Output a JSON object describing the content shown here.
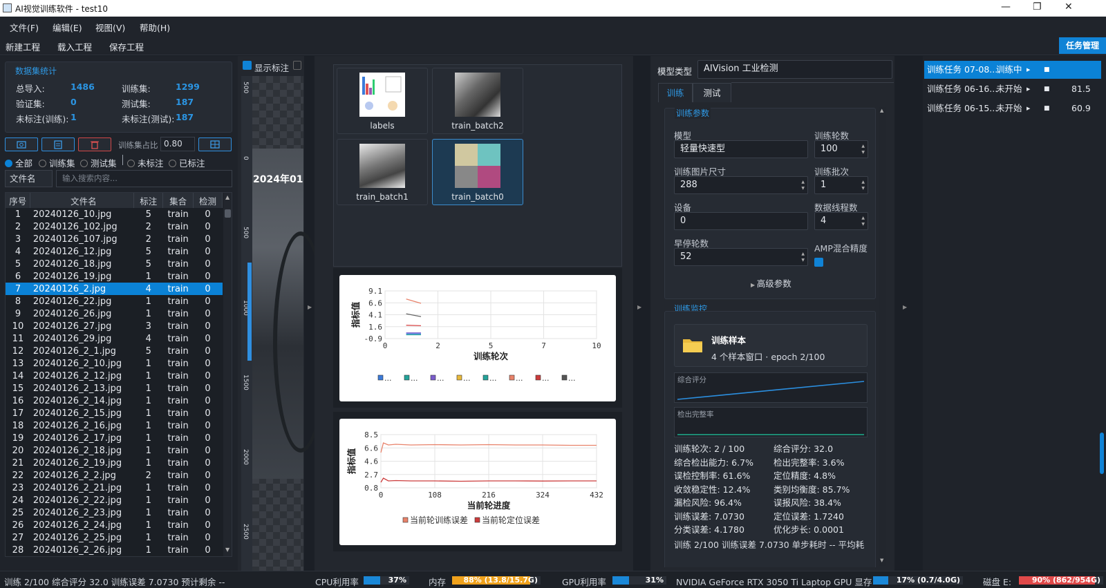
{
  "window": {
    "title": "AI视觉训练软件 - test10",
    "minimize": "—",
    "maximize": "❐",
    "close": "✕"
  },
  "menu": [
    "文件(F)",
    "编辑(E)",
    "视图(V)",
    "帮助(H)"
  ],
  "toolbar": {
    "new": "新建工程",
    "load": "载入工程",
    "save": "保存工程",
    "tasks": "任务管理"
  },
  "dataset": {
    "title": "数据集统计",
    "total_label": "总导入:",
    "total": "1486",
    "train_label": "训练集:",
    "train": "1299",
    "val_label": "验证集:",
    "val": "0",
    "test_label": "测试集:",
    "test": "187",
    "unl_train_label": "未标注(训练):",
    "unl_train": "1",
    "unl_test_label": "未标注(测试):",
    "unl_test": "187",
    "ratio_label": "训练集占比",
    "ratio": "0.80"
  },
  "filters": {
    "all": "全部",
    "train": "训练集",
    "test": "测试集",
    "unlabeled": "未标注",
    "labeled": "已标注"
  },
  "search": {
    "field": "文件名",
    "placeholder": "输入搜索内容..."
  },
  "table": {
    "headers": [
      "序号",
      "文件名",
      "标注",
      "集合",
      "检测"
    ],
    "selected_index": 6,
    "rows": [
      [
        "1",
        "20240126_10.jpg",
        "5",
        "train",
        "0"
      ],
      [
        "2",
        "20240126_102.jpg",
        "2",
        "train",
        "0"
      ],
      [
        "3",
        "20240126_107.jpg",
        "2",
        "train",
        "0"
      ],
      [
        "4",
        "20240126_12.jpg",
        "5",
        "train",
        "0"
      ],
      [
        "5",
        "20240126_18.jpg",
        "5",
        "train",
        "0"
      ],
      [
        "6",
        "20240126_19.jpg",
        "1",
        "train",
        "0"
      ],
      [
        "7",
        "20240126_2.jpg",
        "4",
        "train",
        "0"
      ],
      [
        "8",
        "20240126_22.jpg",
        "1",
        "train",
        "0"
      ],
      [
        "9",
        "20240126_26.jpg",
        "1",
        "train",
        "0"
      ],
      [
        "10",
        "20240126_27.jpg",
        "3",
        "train",
        "0"
      ],
      [
        "11",
        "20240126_29.jpg",
        "4",
        "train",
        "0"
      ],
      [
        "12",
        "20240126_2_1.jpg",
        "5",
        "train",
        "0"
      ],
      [
        "13",
        "20240126_2_10.jpg",
        "1",
        "train",
        "0"
      ],
      [
        "14",
        "20240126_2_12.jpg",
        "1",
        "train",
        "0"
      ],
      [
        "15",
        "20240126_2_13.jpg",
        "1",
        "train",
        "0"
      ],
      [
        "16",
        "20240126_2_14.jpg",
        "1",
        "train",
        "0"
      ],
      [
        "17",
        "20240126_2_15.jpg",
        "1",
        "train",
        "0"
      ],
      [
        "18",
        "20240126_2_16.jpg",
        "1",
        "train",
        "0"
      ],
      [
        "19",
        "20240126_2_17.jpg",
        "1",
        "train",
        "0"
      ],
      [
        "20",
        "20240126_2_18.jpg",
        "1",
        "train",
        "0"
      ],
      [
        "21",
        "20240126_2_19.jpg",
        "1",
        "train",
        "0"
      ],
      [
        "22",
        "20240126_2_2.jpg",
        "2",
        "train",
        "0"
      ],
      [
        "23",
        "20240126_2_21.jpg",
        "1",
        "train",
        "0"
      ],
      [
        "24",
        "20240126_2_22.jpg",
        "1",
        "train",
        "0"
      ],
      [
        "25",
        "20240126_2_23.jpg",
        "1",
        "train",
        "0"
      ],
      [
        "26",
        "20240126_2_24.jpg",
        "1",
        "train",
        "0"
      ],
      [
        "27",
        "20240126_2_25.jpg",
        "1",
        "train",
        "0"
      ],
      [
        "28",
        "20240126_2_26.jpg",
        "1",
        "train",
        "0"
      ]
    ]
  },
  "viewer": {
    "show_label": "显示标注",
    "ruler": [
      "500",
      "0",
      "500",
      "1000",
      "1500",
      "2000",
      "2500"
    ],
    "overlay_text": "2024年01"
  },
  "thumbs": [
    "labels",
    "train_batch2",
    "train_batch1",
    "train_batch0"
  ],
  "chart_data": [
    {
      "type": "line",
      "xlabel": "训练轮次",
      "ylabel": "指标值",
      "xlim": [
        0,
        10
      ],
      "ylim": [
        -0.9,
        9.1
      ],
      "xticks": [
        "0",
        "2",
        "5",
        "7",
        "10"
      ],
      "yticks": [
        "9.1",
        "6.6",
        "4.1",
        "1.6",
        "-0.9"
      ],
      "legend": [
        "...",
        "...",
        "...",
        "...",
        "...",
        "...",
        "...",
        "..."
      ],
      "series": [
        {
          "color": "#e8826a",
          "x": [
            1,
            1.7
          ],
          "y": [
            7.4,
            6.5
          ]
        },
        {
          "color": "#666666",
          "x": [
            1,
            1.7
          ],
          "y": [
            4.3,
            3.7
          ]
        },
        {
          "color": "#d94c4c",
          "x": [
            1,
            1.7
          ],
          "y": [
            1.9,
            1.8
          ]
        },
        {
          "color": "#3b7ad9",
          "x": [
            1,
            1.7
          ],
          "y": [
            0.1,
            0.1
          ]
        },
        {
          "color": "#23a39a",
          "x": [
            1,
            1.7
          ],
          "y": [
            -0.1,
            -0.1
          ]
        },
        {
          "color": "#7a5ccc",
          "x": [
            1,
            1.7
          ],
          "y": [
            0.3,
            0.3
          ]
        }
      ]
    },
    {
      "type": "line",
      "xlabel": "当前轮进度",
      "ylabel": "指标值",
      "xlim": [
        0,
        432
      ],
      "ylim": [
        0.8,
        8.5
      ],
      "xticks": [
        "0",
        "108",
        "216",
        "324",
        "432"
      ],
      "yticks": [
        "8.5",
        "6.6",
        "4.6",
        "2.7",
        "0.8"
      ],
      "series": [
        {
          "name": "当前轮训练误差",
          "color": "#e8826a",
          "x": [
            0,
            5,
            15,
            30,
            60,
            108,
            160,
            216,
            270,
            324,
            380,
            432
          ],
          "y": [
            5.9,
            7.3,
            7.0,
            7.1,
            7.0,
            7.05,
            7.0,
            7.05,
            7.0,
            7.0,
            6.95,
            6.95
          ]
        },
        {
          "name": "当前轮定位误差",
          "color": "#cc3c3c",
          "x": [
            0,
            5,
            15,
            30,
            60,
            108,
            160,
            216,
            270,
            324,
            380,
            432
          ],
          "y": [
            1.6,
            2.2,
            1.8,
            1.85,
            1.8,
            1.8,
            1.75,
            1.8,
            1.8,
            1.78,
            1.8,
            1.8
          ]
        }
      ]
    }
  ],
  "model": {
    "type_label": "模型类型",
    "type_value": "AIVision 工业检测",
    "tabs": [
      "训练",
      "测试"
    ],
    "params_title": "训练参数",
    "model_label": "模型",
    "model_value": "轻量快速型",
    "epochs_label": "训练轮数",
    "epochs": "100",
    "imgsz_label": "训练图片尺寸",
    "imgsz": "288",
    "batch_label": "训练批次",
    "batch": "1",
    "device_label": "设备",
    "device": "0",
    "workers_label": "数据线程数",
    "workers": "4",
    "patience_label": "早停轮数",
    "patience": "52",
    "amp_label": "AMP混合精度",
    "advanced": "高级参数"
  },
  "monitor": {
    "title": "训练监控",
    "sample_title": "训练样本",
    "sample_sub": "4 个样本窗口 · epoch 2/100",
    "spark1": "综合评分",
    "spark2": "检出完整率",
    "metrics": [
      [
        "训练轮次: 2 / 100",
        "综合评分: 32.0"
      ],
      [
        "综合检出能力: 6.7%",
        "检出完整率: 3.6%"
      ],
      [
        "误检控制率: 61.6%",
        "定位精度: 4.8%"
      ],
      [
        "收敛稳定性: 12.4%",
        "类别均衡度: 85.7%"
      ],
      [
        "漏检风险: 96.4%",
        "误报风险: 38.4%"
      ],
      [
        "训练误差: 7.0730",
        "定位误差: 1.7240"
      ],
      [
        "分类误差: 4.1780",
        "优化步长: 0.0001"
      ]
    ],
    "log": "训练 2/100  训练误差 7.0730  单步耗时 --  平均耗"
  },
  "tasks": [
    {
      "name": "训练任务 07-08...",
      "state": "训练中",
      "val": ""
    },
    {
      "name": "训练任务 06-16...",
      "state": "未开始",
      "val": "81.5"
    },
    {
      "name": "训练任务 06-15...",
      "state": "未开始",
      "val": "60.9"
    }
  ],
  "status": {
    "left": "训练 2/100  综合评分 32.0  训练误差 7.0730  预计剩余 --",
    "cpu_label": "CPU利用率",
    "cpu": "37%",
    "cpu_fill": 0.37,
    "mem_label": "内存",
    "mem": "88% (13.8/15.7G)",
    "mem_fill": 0.88,
    "gpu_label": "GPU利用率",
    "gpu": "31%",
    "gpu_fill": 0.31,
    "gpu_name": "NVIDIA GeForce RTX 3050 Ti Laptop GPU 显存",
    "vram": "17% (0.7/4.0G)",
    "vram_fill": 0.17,
    "disk_label": "磁盘 E:",
    "disk": "90% (862/954G)",
    "disk_fill": 0.9
  }
}
